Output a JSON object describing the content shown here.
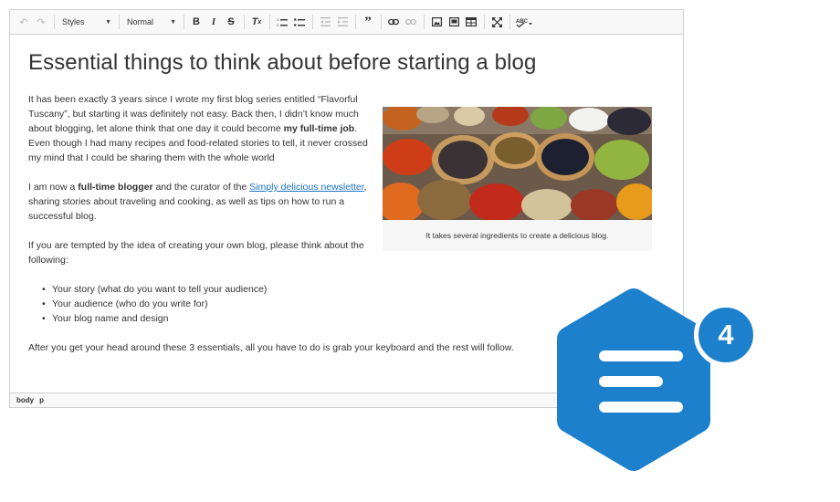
{
  "toolbar": {
    "styles_label": "Styles",
    "format_label": "Normal"
  },
  "content": {
    "title": "Essential things to think about before starting a blog",
    "p1_a": "It has been exactly 3 years since I wrote my first blog series entitled “Flavorful Tuscany”, but starting it was definitely not easy. Back then, I didn’t know much about blogging, let alone think that one day it could become ",
    "p1_bold": "my full-time job",
    "p1_b": ". Even though I had many recipes and food-related stories to tell, it never crossed my mind that I could be sharing them with the whole world",
    "p2_a": "I am now a ",
    "p2_bold": "full-time blogger",
    "p2_b": " and the curator of the ",
    "p2_link": "Simply delicious newsletter",
    "p2_c": ", sharing stories about traveling and cooking, as well as tips on how to run a successful blog.",
    "p3": "If you are tempted by the idea of creating your own blog, please think about the following:",
    "list": [
      "Your story (what do you want to tell your audience)",
      "Your audience (who do you write for)",
      "Your blog name and design"
    ],
    "p4": "After you get your head around these 3 essentials, all you have to do is grab your keyboard and the rest will follow.",
    "caption": "It takes several ingredients to create a delicious blog."
  },
  "statusbar": {
    "path_body": "body",
    "path_p": "p"
  },
  "badge": {
    "count": "4",
    "color": "#1d80cc"
  }
}
